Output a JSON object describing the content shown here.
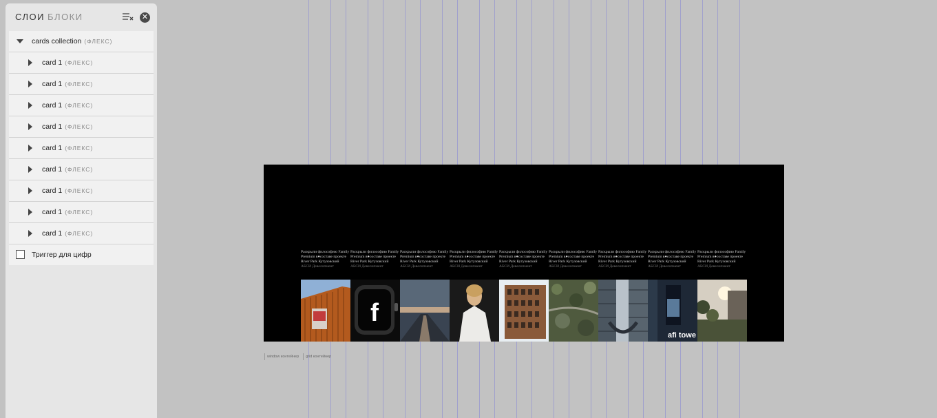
{
  "panel": {
    "tabs": [
      "СЛОИ",
      "БЛОКИ"
    ],
    "active_tab": "СЛОИ",
    "icons": {
      "collapse": "collapse-list-icon",
      "close": "close-icon"
    },
    "root": {
      "name": "cards collection",
      "tag": "(ФЛЕКС)"
    },
    "children": [
      {
        "name": "card 1",
        "tag": "(ФЛЕКС)"
      },
      {
        "name": "card 1",
        "tag": "(ФЛЕКС)"
      },
      {
        "name": "card 1",
        "tag": "(ФЛЕКС)"
      },
      {
        "name": "card 1",
        "tag": "(ФЛЕКС)"
      },
      {
        "name": "card 1",
        "tag": "(ФЛЕКС)"
      },
      {
        "name": "card 1",
        "tag": "(ФЛЕКС)"
      },
      {
        "name": "card 1",
        "tag": "(ФЛЕКС)"
      },
      {
        "name": "card 1",
        "tag": "(ФЛЕКС)"
      },
      {
        "name": "card 1",
        "tag": "(ФЛЕКС)"
      }
    ],
    "trigger": {
      "label": "Триггер для цифр",
      "checked": false
    }
  },
  "cards": [
    {
      "text": "Раскрыли философию Family Premium в●составе проекте River Park Кутузовский",
      "sub": "АБСИ Девелопмент",
      "image": "building-facade-billboard"
    },
    {
      "text": "Раскрыли философию Family Premium в●составе проекте River Park Кутузовский",
      "sub": "АБСИ Девелопмент",
      "image": "smartwatch"
    },
    {
      "text": "Раскрыли философию Family Premium в●составе проекте River Park Кутузовский",
      "sub": "АБСИ Девелопмент",
      "image": "city-river-view"
    },
    {
      "text": "Раскрыли философию Family Premium в●составе проекте River Park Кутузовский",
      "sub": "АБСИ Девелопмент",
      "image": "woman-portrait"
    },
    {
      "text": "Раскрыли философию Family Premium в●составе проекте River Park Кутузовский",
      "sub": "АБСИ Девелопмент",
      "image": "brick-building"
    },
    {
      "text": "Раскрыли философию Family Premium в●составе проекте River Park Кутузовский",
      "sub": "АБСИ Девелопмент",
      "image": "aerial-greenery"
    },
    {
      "text": "Раскрыли философию Family Premium в●составе проекте River Park Кутузовский",
      "sub": "АБСИ Девелопмент",
      "image": "glass-towers"
    },
    {
      "text": "Раскрыли философию Family Premium в●составе проекте River Park Кутузовский",
      "sub": "АБСИ Девелопмент",
      "image": "afi-tower-poster",
      "caption": "afi towe"
    },
    {
      "text": "Раскрыли философию Family Premium в●составе проекте River Park Кутузовский",
      "sub": "АБСИ Девелопмент",
      "image": "courtyard-sunset"
    }
  ],
  "watch_glyph": "f",
  "frame_labels": [
    "window контейнер",
    "grid контейнер"
  ],
  "colors": {
    "canvas_bg": "#000000",
    "workspace_bg": "#c2c2c2",
    "panel_bg": "#e6e6e6",
    "guide": "#7878dc"
  }
}
